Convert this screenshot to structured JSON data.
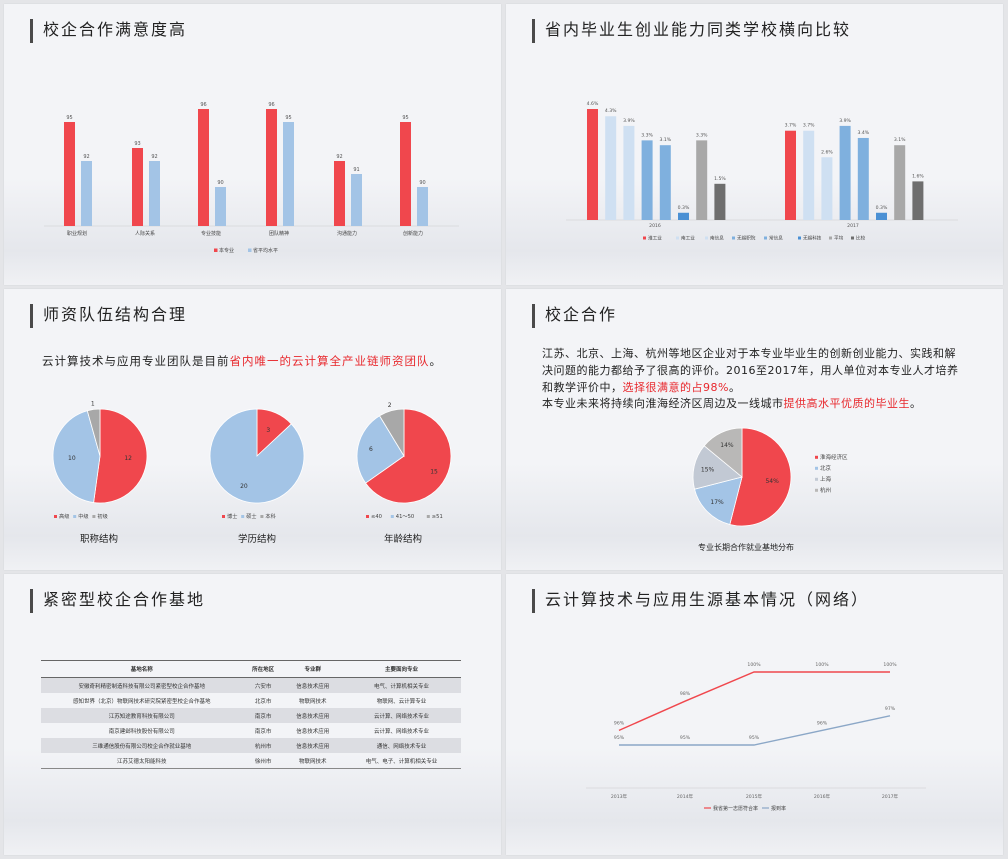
{
  "slides": [
    {
      "title": "校企合作满意度高"
    },
    {
      "title": "省内毕业生创业能力同类学校横向比较"
    },
    {
      "title": "师资队伍结构合理"
    },
    {
      "title": "校企合作"
    },
    {
      "title": "紧密型校企合作基地"
    },
    {
      "title": "云计算技术与应用生源基本情况（网络）"
    }
  ],
  "slide3_text": {
    "before": "云计算技术与应用专业团队是目前",
    "highlight": "省内唯一的云计算全产业链师资团队",
    "after": "。"
  },
  "slide4_text": {
    "p1_before": "江苏、北京、上海、杭州等地区企业对于本专业毕业生的创新创业能力、实践和解决问题的能力都给予了很高的评价。2016至2017年，用人单位对本专业人才培养和教学评价中，",
    "p1_highlight": "选择很满意的占98%",
    "p1_after": "。",
    "p2_before": "本专业未来将持续向淮海经济区周边及一线城市",
    "p2_highlight": "提供高水平优质的毕业生",
    "p2_after": "。",
    "pie_caption": "专业长期合作就业基地分布"
  },
  "pie_captions": [
    "职称结构",
    "学历结构",
    "年龄结构"
  ],
  "colors": {
    "red": "#f0474d",
    "light_blue": "#a3c4e6",
    "grey": "#a8a8a8",
    "pale_blue": "#cfe0f2",
    "mid_blue": "#7fb0de",
    "blue": "#4a90d4",
    "dark_grey": "#6e6e6e"
  },
  "chart_data": [
    {
      "type": "bar",
      "categories": [
        "职业规划",
        "人际关系",
        "专业技能",
        "团队精神",
        "沟通能力",
        "创新能力"
      ],
      "series": [
        {
          "name": "本专业",
          "values": [
            95,
            93,
            96,
            96,
            92,
            95
          ]
        },
        {
          "name": "省平均水平",
          "values": [
            92,
            92,
            90,
            95,
            91,
            90
          ]
        }
      ]
    },
    {
      "type": "bar",
      "categories": [
        "2016",
        "2017"
      ],
      "series": [
        {
          "name": "淮工业",
          "values": [
            4.6,
            3.7
          ]
        },
        {
          "name": "南工业",
          "values": [
            4.3,
            3.7
          ]
        },
        {
          "name": "南信息",
          "values": [
            3.9,
            2.6
          ]
        },
        {
          "name": "无锡职院",
          "values": [
            3.3,
            3.9
          ]
        },
        {
          "name": "常信息",
          "values": [
            3.1,
            3.4
          ]
        },
        {
          "name": "无锡科技",
          "values": [
            0.3,
            0.3
          ]
        },
        {
          "name": "平均",
          "values": [
            3.3,
            3.1
          ]
        },
        {
          "name": "比较",
          "values": [
            1.5,
            1.6
          ]
        }
      ],
      "value_labels": [
        "4.6%",
        "4.3%",
        "3.9%",
        "3.3%",
        "3.1%",
        "0.3%",
        "3.3%",
        "1.5%",
        "3.7%",
        "3.7%",
        "2.6%",
        "3.9%",
        "3.4%",
        "0.3%",
        "3.1%",
        "1.6%"
      ]
    },
    {
      "type": "pie",
      "title": "职称结构",
      "labels": [
        "高级",
        "中级",
        "初级"
      ],
      "values": [
        12,
        10,
        1
      ]
    },
    {
      "type": "pie",
      "title": "学历结构",
      "labels": [
        "博士",
        "硕士",
        "本科"
      ],
      "values": [
        3,
        20,
        0
      ]
    },
    {
      "type": "pie",
      "title": "年龄结构",
      "labels": [
        "≤40",
        "41～50",
        "≥51"
      ],
      "values": [
        15,
        6,
        2
      ]
    },
    {
      "type": "pie",
      "title": "专业长期合作就业基地分布",
      "labels": [
        "淮海经济区",
        "北京",
        "上海",
        "杭州"
      ],
      "values": [
        54,
        17,
        15,
        14
      ],
      "value_labels": [
        "54%",
        "17%",
        "15%",
        "14%"
      ]
    },
    {
      "type": "table",
      "columns": [
        "基地名称",
        "所在地区",
        "专业群",
        "主要面向专业"
      ],
      "rows": [
        [
          "安徽奇利精密制造科技有限公司紧密型校企合作基地",
          "六安市",
          "信息技术应用",
          "电气、计算机相关专业"
        ],
        [
          "感知世界（北京）物联网技术研究院紧密型校企合作基地",
          "北京市",
          "物联网技术",
          "物联网、云计算专业"
        ],
        [
          "江苏知途教育科技有限公司",
          "南京市",
          "信息技术应用",
          "云计算、网络技术专业"
        ],
        [
          "南京建邺科技股份有限公司",
          "南京市",
          "信息技术应用",
          "云计算、网络技术专业"
        ],
        [
          "三维通信股份有限公司校企合作就业基地",
          "杭州市",
          "信息技术应用",
          "通信、网络技术专业"
        ],
        [
          "江苏艾德太阳能科技",
          "徐州市",
          "物联网技术",
          "电气、电子、计算机相关专业"
        ]
      ]
    },
    {
      "type": "line",
      "x": [
        "2013年",
        "2014年",
        "2015年",
        "2016年",
        "2017年"
      ],
      "series": [
        {
          "name": "我省第一志愿符合率",
          "values": [
            96,
            98,
            100,
            100,
            100
          ],
          "labels": [
            "96%",
            "98%",
            "100%",
            "100%",
            "100%"
          ]
        },
        {
          "name": "报到率",
          "values": [
            95,
            95,
            95,
            96,
            97
          ],
          "labels": [
            "95%",
            "95%",
            "95%",
            "96%",
            "97%"
          ]
        }
      ]
    }
  ]
}
